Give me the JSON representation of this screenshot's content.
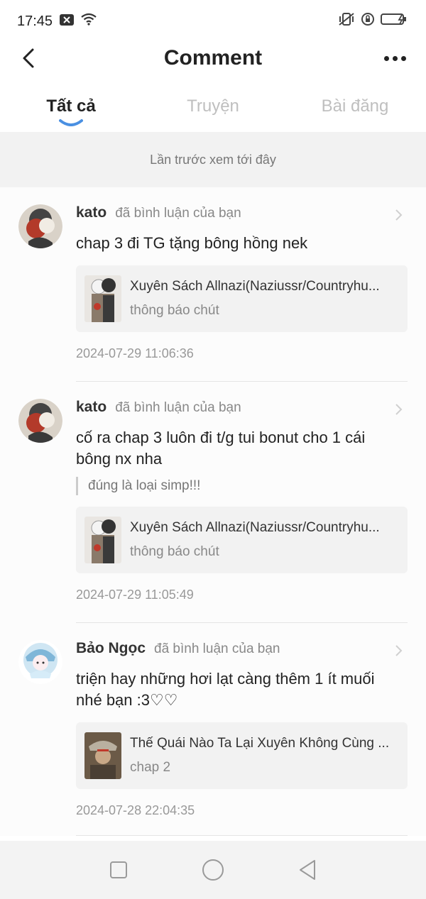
{
  "status_bar": {
    "time": "17:45"
  },
  "header": {
    "title": "Comment"
  },
  "tabs": [
    {
      "label": "Tất cả",
      "active": true
    },
    {
      "label": "Truyện",
      "active": false
    },
    {
      "label": "Bài đăng",
      "active": false
    }
  ],
  "notice": "Lần trước xem tới đây",
  "comments": [
    {
      "username": "kato",
      "action": "đã bình luận của bạn",
      "text": "chap 3 đi TG tặng bông hồng nek",
      "quote": "",
      "story_title": "Xuyên Sách Allnazi(Naziussr/Countryhu...",
      "story_sub": "thông báo chút",
      "time": "2024-07-29 11:06:36"
    },
    {
      "username": "kato",
      "action": "đã bình luận của bạn",
      "text": "cố ra chap 3 luôn đi t/g tui bonut cho 1 cái bông nx nha",
      "quote": "đúng là loại simp!!!",
      "story_title": "Xuyên Sách Allnazi(Naziussr/Countryhu...",
      "story_sub": "thông báo chút",
      "time": "2024-07-29 11:05:49"
    },
    {
      "username": "Bảo Ngọc",
      "action": "đã bình luận của bạn",
      "text": "triện hay những hơi lạt càng thêm 1 ít muối nhé bạn :3♡♡",
      "quote": "",
      "story_title": "Thế Quái Nào Ta Lại Xuyên Không Cùng ...",
      "story_sub": "chap 2",
      "time": "2024-07-28 22:04:35"
    }
  ],
  "colors": {
    "accent": "#4a90e2",
    "background": "#fcfcfc",
    "notice_bg": "#f2f2f2"
  },
  "icons": {
    "back": "chevron-left-icon",
    "more": "more-dots-icon",
    "recent_apps": "square-icon",
    "home": "circle-icon",
    "back_nav": "triangle-back-icon"
  }
}
